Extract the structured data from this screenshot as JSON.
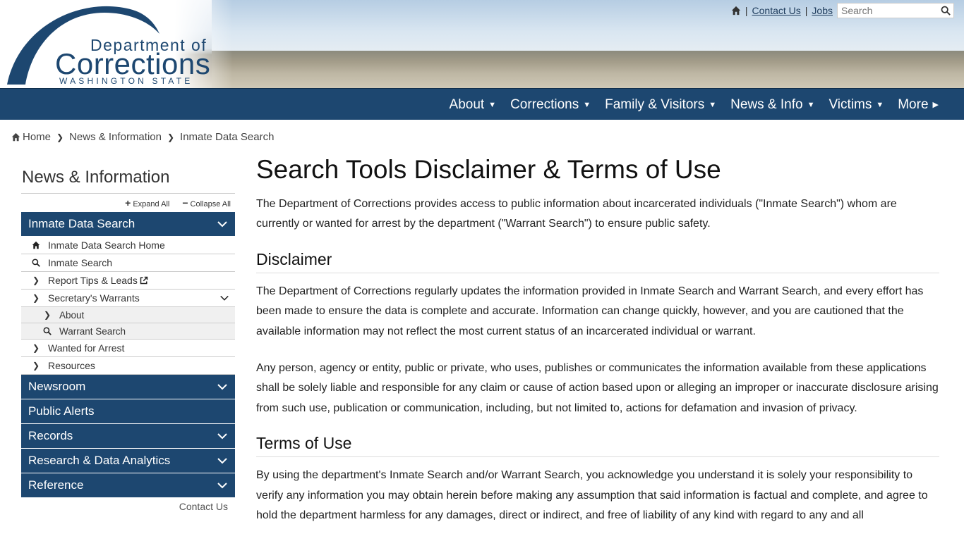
{
  "header": {
    "logo": {
      "line1": "Department of",
      "line2": "Corrections",
      "line3": "WASHINGTON STATE"
    },
    "utility": {
      "home_icon": "home-icon",
      "contact_label": "Contact Us",
      "jobs_label": "Jobs",
      "search_placeholder": "Search",
      "search_icon": "search-icon"
    }
  },
  "nav": {
    "items": [
      {
        "label": "About"
      },
      {
        "label": "Corrections"
      },
      {
        "label": "Family & Visitors"
      },
      {
        "label": "News & Info"
      },
      {
        "label": "Victims"
      },
      {
        "label": "More"
      }
    ]
  },
  "breadcrumb": {
    "items": [
      "Home",
      "News & Information",
      "Inmate Data Search"
    ]
  },
  "sidebar": {
    "title": "News & Information",
    "expand_all": "Expand All",
    "collapse_all": "Collapse All",
    "section_title": "Inmate Data Search",
    "items": [
      {
        "label": "Inmate Data Search Home",
        "icon": "home-icon"
      },
      {
        "label": "Inmate Search",
        "icon": "search-icon"
      },
      {
        "label": "Report Tips & Leads",
        "icon": "chevron-right-icon"
      },
      {
        "label": "Secretary's Warrants",
        "icon": "chevron-right-icon"
      },
      {
        "label": "About",
        "icon": "chevron-right-icon"
      },
      {
        "label": "Warrant Search",
        "icon": "search-icon"
      },
      {
        "label": "Wanted for Arrest",
        "icon": "chevron-right-icon"
      },
      {
        "label": "Resources",
        "icon": "chevron-right-icon"
      }
    ],
    "sections": [
      {
        "label": "Newsroom"
      },
      {
        "label": "Public Alerts"
      },
      {
        "label": "Records"
      },
      {
        "label": "Research & Data Analytics"
      },
      {
        "label": "Reference"
      }
    ],
    "footer_link": "Contact Us"
  },
  "main": {
    "title": "Search Tools Disclaimer & Terms of Use",
    "intro": "The Department of Corrections provides access to public information about incarcerated individuals (\"Inmate Search\") whom are currently or wanted for arrest by the department (\"Warrant Search\") to ensure public safety.",
    "disclaimer_heading": "Disclaimer",
    "disclaimer_p1": "The Department of Corrections regularly updates the information provided in Inmate Search and Warrant Search, and every effort has been made to ensure the data is complete and accurate. Information can change quickly, however, and you are cautioned that the available information may not reflect the most current status of an incarcerated individual or warrant.",
    "disclaimer_p2": "Any person, agency or entity, public or private, who uses, publishes or communicates the information available from these applications shall be solely liable and responsible for any claim or cause of action based upon or alleging an improper or inaccurate disclosure arising from such use, publication or communication, including, but not limited to, actions for defamation and invasion of privacy.",
    "terms_heading": "Terms of Use",
    "terms_p1": "By using the department's Inmate Search and/or Warrant Search, you acknowledge you understand it is solely your responsibility to verify any information you may obtain herein before making any assumption that said information is factual and complete, and agree to hold the department harmless for any damages, direct or indirect, and free of liability of any kind with regard to any and all"
  },
  "colors": {
    "brand_navy": "#1d4770",
    "sidebar_sub_bg": "#f0f0f0"
  }
}
